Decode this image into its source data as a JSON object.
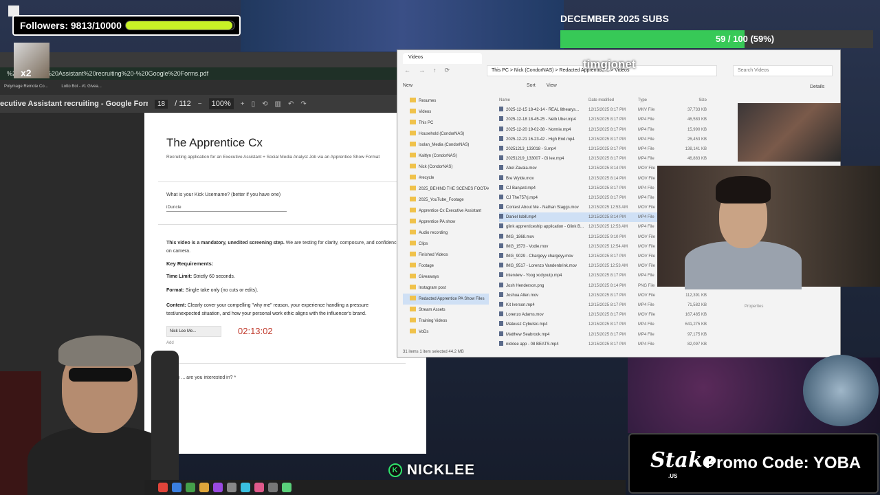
{
  "overlay": {
    "followers_label": "Followers: 9813/10000",
    "followers_progress": 0.9813,
    "subs_title": "DECEMBER 2025 SUBS",
    "subs_text": "59 / 100 (59%)",
    "subs_progress": 0.59,
    "watermark": "timgjonet",
    "promo_brand": "Stake",
    "promo_brand_suffix": ".US",
    "promo_text": "Promo Code: YOBA",
    "nick_banner": "NICKLEE",
    "x2_badge": "x2"
  },
  "pdf": {
    "address": "%20Executive%20Assistant%20recruiting%20-%20Google%20Forms.pdf",
    "bookmarks": [
      "Polymage Remote Co...",
      "Lotto Bot - #1 Givea..."
    ],
    "title": "ecutive Assistant recruiting - Google Forms....",
    "page_current": "18",
    "page_total": "/ 112",
    "zoom": "100%"
  },
  "form": {
    "title": "The Apprentice Cx",
    "description": "Recruiting application for an Executive Assistant + Social Media Analyst Job via an Apprentice Show Format",
    "q1": "What is your Kick Username? (better if you have one)",
    "a1": "iDuncle",
    "intro_bold": "This video is a mandatory, unedited screening step.",
    "intro_rest": " We are testing for clarity, composure, and confidence on camera.",
    "key_req": "Key Requirements:",
    "time_limit_label": "Time Limit:",
    "time_limit_value": " Strictly 60 seconds.",
    "format_label": "Format:",
    "format_value": " Single take only (no cuts or edits).",
    "content_label": "Content:",
    "content_value": " Clearly cover your compelling \"why me\" reason, your experience handling a pressure test/unexpected situation, and how your personal work ethic aligns with the influencer's brand.",
    "file_chip": "Nick Lee Me...",
    "add_file": "Add",
    "timer": "02:13:02",
    "q2": "Which ... are you interested in? *"
  },
  "explorer": {
    "tab": "Videos",
    "address": "This PC  >  Nick (CondorNAS)  >  Redacted Apprentice ...  >  Videos",
    "search_placeholder": "Search Videos",
    "cmd": [
      "New",
      "Sort",
      "View",
      "Details"
    ],
    "columns": [
      "Name",
      "Date modified",
      "Type",
      "Size"
    ],
    "tree": [
      {
        "label": "Resumes",
        "sel": false
      },
      {
        "label": "Videos",
        "sel": false
      },
      {
        "label": "This PC",
        "sel": false
      },
      {
        "label": "Household (CondorNAS)",
        "sel": false
      },
      {
        "label": "Isolan_Media (CondorNAS)",
        "sel": false
      },
      {
        "label": "Kaitlyn (CondorNAS)",
        "sel": false
      },
      {
        "label": "Nick (CondorNAS)",
        "sel": false
      },
      {
        "label": "#recycle",
        "sel": false
      },
      {
        "label": "2025_BEHIND THE SCENES FOOTAGE",
        "sel": false
      },
      {
        "label": "2025_YouTube_Footage",
        "sel": false
      },
      {
        "label": "Apprentice Cx Executive Assistant",
        "sel": false
      },
      {
        "label": "Apprentice PA show",
        "sel": false
      },
      {
        "label": "Audio recording",
        "sel": false
      },
      {
        "label": "Clips",
        "sel": false
      },
      {
        "label": "Finished Videos",
        "sel": false
      },
      {
        "label": "Footage",
        "sel": false
      },
      {
        "label": "Giveaways",
        "sel": false
      },
      {
        "label": "Instagram post",
        "sel": false
      },
      {
        "label": "Redacted Apprentice PA Show Files",
        "sel": true
      },
      {
        "label": "Stream Assets",
        "sel": false
      },
      {
        "label": "Training Videos",
        "sel": false
      },
      {
        "label": "VoDs",
        "sel": false
      }
    ],
    "files": [
      {
        "name": "2025-12-15 18-42-14 - REAL lithearys...",
        "date": "12/15/2025 8:17 PM",
        "type": "MKV File",
        "size": "37,733 KB",
        "sel": false
      },
      {
        "name": "2025-12-18 18-45-25 - Nelb Uber.mp4",
        "date": "12/15/2025 8:17 PM",
        "type": "MP4 File",
        "size": "46,583 KB",
        "sel": false
      },
      {
        "name": "2025-12-20 19-02-38 - Normie.mp4",
        "date": "12/15/2025 8:17 PM",
        "type": "MP4 File",
        "size": "15,990 KB",
        "sel": false
      },
      {
        "name": "2025-12-21 16-23-42 - High End.mp4",
        "date": "12/15/2025 8:17 PM",
        "type": "MP4 File",
        "size": "26,453 KB",
        "sel": false
      },
      {
        "name": "20251213_133018 - S.mp4",
        "date": "12/15/2025 8:17 PM",
        "type": "MP4 File",
        "size": "138,141 KB",
        "sel": false
      },
      {
        "name": "20251219_133007 - Gi lee.mp4",
        "date": "12/15/2025 8:17 PM",
        "type": "MP4 File",
        "size": "46,883 KB",
        "sel": false
      },
      {
        "name": "Abel Zavala.mov",
        "date": "12/15/2025 8:14 PM",
        "type": "MOV File",
        "size": "",
        "sel": false
      },
      {
        "name": "Bre Wylde.mov",
        "date": "12/15/2025 8:14 PM",
        "type": "MOV File",
        "size": "",
        "sel": false
      },
      {
        "name": "CJ Banjard.mp4",
        "date": "12/15/2025 8:17 PM",
        "type": "MP4 File",
        "size": "",
        "sel": false
      },
      {
        "name": "CJ The757rj.mp4",
        "date": "12/15/2025 8:17 PM",
        "type": "MP4 File",
        "size": "",
        "sel": false
      },
      {
        "name": "Contest About Me - Nathan Staggs.mov",
        "date": "12/15/2025 12:53 AM",
        "type": "MOV File",
        "size": "",
        "sel": false
      },
      {
        "name": "Daniel Isbill.mp4",
        "date": "12/15/2025 8:14 PM",
        "type": "MP4 File",
        "size": "",
        "sel": true
      },
      {
        "name": "glink apprenticeship application - Glink B...",
        "date": "12/15/2025 12:53 AM",
        "type": "MP4 File",
        "size": "",
        "sel": false
      },
      {
        "name": "IMG_1868.mov",
        "date": "12/15/2025 9:10 PM",
        "type": "MOV File",
        "size": "",
        "sel": false
      },
      {
        "name": "IMG_1573 - Vodie.mov",
        "date": "12/15/2025 12:54 AM",
        "type": "MOV File",
        "size": "",
        "sel": false
      },
      {
        "name": "IMG_9029 - Chargeyy chargeyy.mov",
        "date": "12/15/2025 8:17 PM",
        "type": "MOV File",
        "size": "",
        "sel": false
      },
      {
        "name": "IMG_9517 - Lorenzo Vandenbrink.mov",
        "date": "12/15/2025 12:53 AM",
        "type": "MOV File",
        "size": "",
        "sel": false
      },
      {
        "name": "interview - Yoog xodyxutp.mp4",
        "date": "12/15/2025 8:17 PM",
        "type": "MP4 File",
        "size": "",
        "sel": false
      },
      {
        "name": "Josh Henderson.png",
        "date": "12/15/2025 8:14 PM",
        "type": "PNG File",
        "size": "",
        "sel": false
      },
      {
        "name": "Joshua Allen.mov",
        "date": "12/15/2025 8:17 PM",
        "type": "MOV File",
        "size": "112,391 KB",
        "sel": false
      },
      {
        "name": "Kit Iverson.mp4",
        "date": "12/15/2025 8:17 PM",
        "type": "MP4 File",
        "size": "71,582 KB",
        "sel": false
      },
      {
        "name": "Lorenzo Adams.mov",
        "date": "12/15/2025 8:17 PM",
        "type": "MOV File",
        "size": "167,485 KB",
        "sel": false
      },
      {
        "name": "Mateusz Cybulski.mp4",
        "date": "12/15/2025 8:17 PM",
        "type": "MP4 File",
        "size": "641,275 KB",
        "sel": false
      },
      {
        "name": "Matthew Seabrook.mp4",
        "date": "12/15/2025 8:17 PM",
        "type": "MP4 File",
        "size": "97,175 KB",
        "sel": false
      },
      {
        "name": "nicklee app - 08 BEATS.mp4",
        "date": "12/15/2025 8:17 PM",
        "type": "MP4 File",
        "size": "82,097 KB",
        "sel": false
      }
    ],
    "status": "31 items    1 item selected  44.2 MB",
    "properties": "Properties"
  },
  "colors": {
    "followers_bar": "#c8f226",
    "subs_bar": "#37c957",
    "timer": "#c0392b",
    "check": "#2e9d4e",
    "nick_accent": "#2fe36b"
  }
}
